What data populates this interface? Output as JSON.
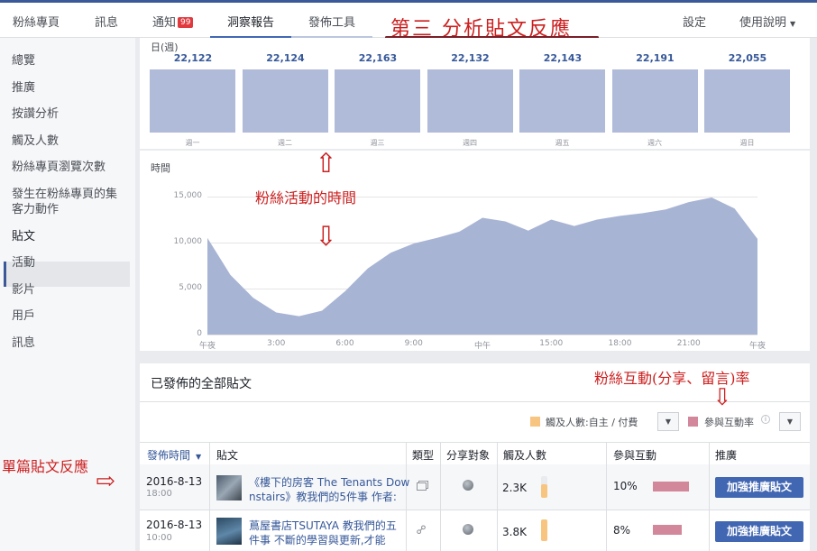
{
  "nav": {
    "fans_page": "粉絲專頁",
    "messages": "訊息",
    "notifications": "通知",
    "notif_badge": "99",
    "insights": "洞察報告",
    "publishing_tools": "發佈工具",
    "settings": "設定",
    "help": "使用說明",
    "help_caret": "▼"
  },
  "annotations": {
    "analyze_posts": "第三 分析貼文反應",
    "fan_activity_time": "粉絲活動的時間",
    "engagement_rate": "粉絲互動(分享、留言)率",
    "single_post": "單篇貼文反應",
    "arrow_right": "⇨",
    "arrow_up": "⇧",
    "arrow_down": "⇩"
  },
  "sidebar": {
    "items": [
      "總覽",
      "推廣",
      "按讚分析",
      "觸及人數",
      "粉絲專頁瀏覽次數",
      "發生在粉絲專頁的集客力動作",
      "貼文",
      "活動",
      "影片",
      "用戶",
      "訊息"
    ]
  },
  "days": {
    "title": "日(週)",
    "values": [
      "22,122",
      "22,124",
      "22,163",
      "22,132",
      "22,143",
      "22,191",
      "22,055"
    ],
    "labels": [
      "週一",
      "週二",
      "週三",
      "週四",
      "週五",
      "週六",
      "週日"
    ]
  },
  "chart_data": {
    "type": "area",
    "title": "時間",
    "xlabel": "",
    "ylabel": "",
    "x_ticks": [
      "午夜",
      "3:00",
      "6:00",
      "9:00",
      "中午",
      "15:00",
      "18:00",
      "21:00",
      "午夜"
    ],
    "y_ticks": [
      "15,000",
      "10,000",
      "5,000",
      "0"
    ],
    "ylim": [
      0,
      17000
    ],
    "x": [
      0,
      1,
      2,
      3,
      4,
      5,
      6,
      7,
      8,
      9,
      10,
      11,
      12,
      13,
      14,
      15,
      16,
      17,
      18,
      19,
      20,
      21,
      22,
      23
    ],
    "values": [
      10500,
      6500,
      4000,
      2400,
      2000,
      2600,
      4700,
      7200,
      8900,
      9900,
      10500,
      11200,
      12700,
      12300,
      11300,
      12500,
      11800,
      12500,
      12900,
      13200,
      13600,
      14400,
      14900,
      13700,
      10400
    ],
    "color": "#a8b4d4"
  },
  "posts": {
    "title": "已發佈的全部貼文",
    "legend_reach": "觸及人數:自主 / 付費",
    "legend_engagement": "參與互動率",
    "reach_color": "#f7c57f",
    "engagement_color": "#d3879b",
    "headers": {
      "published": "發佈時間",
      "post": "貼文",
      "type": "類型",
      "targeting": "分享對象",
      "reach": "觸及人數",
      "engagement": "參與互動",
      "promote": "推廣"
    },
    "rows": [
      {
        "date": "2016-8-13",
        "time": "18:00",
        "text_line1": "《樓下的房客 The Tenants Dow",
        "text_line2": "nstairs》教我們的5件事 作者:",
        "reach": "2.3K",
        "reach_fraction": 0.62,
        "engagement": "10%",
        "engagement_fraction": 1.0,
        "button": "加強推廣貼文"
      },
      {
        "date": "2016-8-13",
        "time": "10:00",
        "text_line1": "蔦屋書店TSUTAYA 教我們的五",
        "text_line2": "件事 不斷的學習與更新,才能",
        "reach": "3.8K",
        "reach_fraction": 1.0,
        "engagement": "8%",
        "engagement_fraction": 0.8,
        "button": "加強推廣貼文"
      }
    ]
  }
}
